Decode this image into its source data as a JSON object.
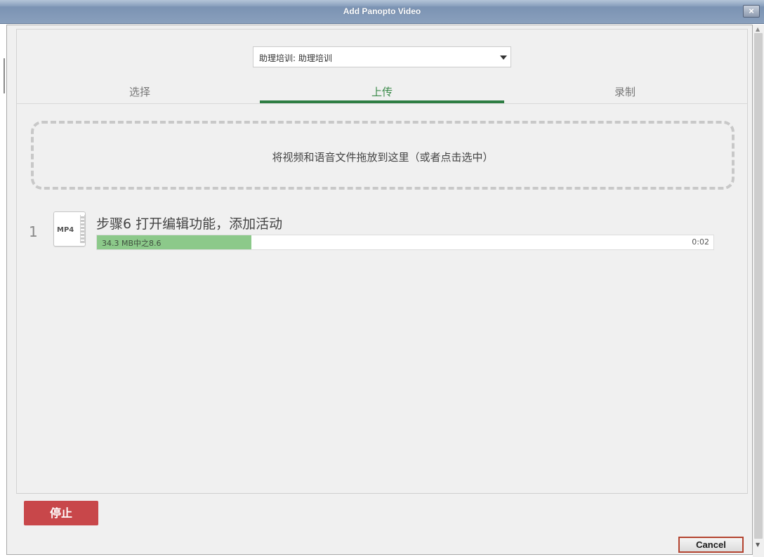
{
  "window": {
    "title": "Add Panopto Video",
    "close_label": "×"
  },
  "folder_select": {
    "value": "助理培训: 助理培训"
  },
  "tabs": [
    {
      "label": "选择",
      "active": false
    },
    {
      "label": "上传",
      "active": true
    },
    {
      "label": "录制",
      "active": false
    }
  ],
  "dropzone": {
    "message": "将视频和语音文件拖放到这里（或者点击选中）"
  },
  "uploads": [
    {
      "index": "1",
      "file_type": "MP4",
      "name": "步骤6 打开编辑功能，添加活动",
      "progress_text": "34.3 MB中之8.6",
      "progress_fraction": 0.25,
      "time": "0:02"
    }
  ],
  "stop_button": {
    "label": "停止"
  },
  "cancel_button": {
    "label": "Cancel"
  },
  "colors": {
    "accent_green": "#2e7d43",
    "progress_green": "#8cc98a",
    "stop_red": "#c8474a"
  }
}
